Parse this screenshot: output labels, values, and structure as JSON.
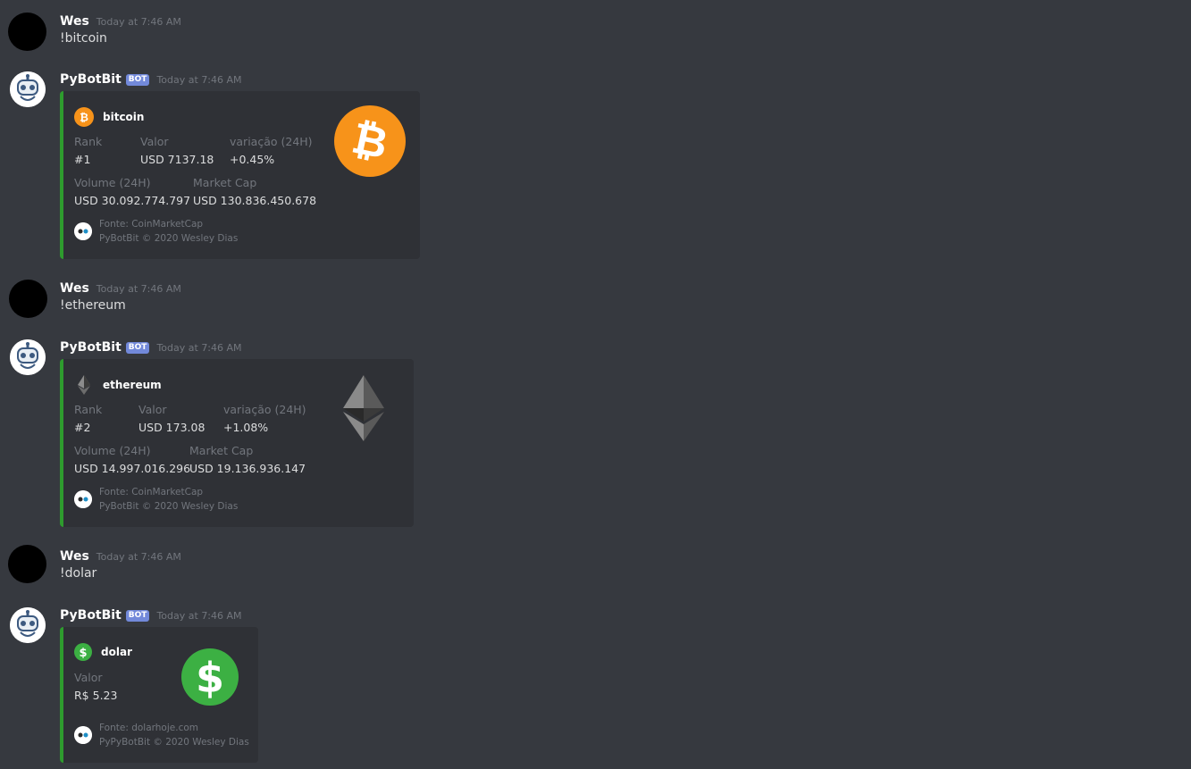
{
  "messages": [
    {
      "type": "user",
      "username": "Wes",
      "timestamp": "Today at 7:46 AM",
      "content": "!bitcoin"
    },
    {
      "type": "bot",
      "username": "PyBotBit",
      "bot_tag": "BOT",
      "timestamp": "Today at 7:46 AM",
      "embed": {
        "accent_color": "#2e9b2e",
        "author": "bitcoin",
        "author_icon": "bitcoin-icon",
        "fields": [
          {
            "name": "Rank",
            "value": "#1"
          },
          {
            "name": "Valor",
            "value": "USD 7137.18"
          },
          {
            "name": "variação (24H)",
            "value": "+0.45%"
          },
          {
            "name": "Volume (24H)",
            "value": "USD 30.092.774.797"
          },
          {
            "name": "Market Cap",
            "value": "USD 130.836.450.678"
          }
        ],
        "thumbnail": "bitcoin-logo",
        "footer_lines": [
          "Fonte: CoinMarketCap",
          "PyBotBit © 2020 Wesley Dias"
        ]
      }
    },
    {
      "type": "user",
      "username": "Wes",
      "timestamp": "Today at 7:46 AM",
      "content": "!ethereum"
    },
    {
      "type": "bot",
      "username": "PyBotBit",
      "bot_tag": "BOT",
      "timestamp": "Today at 7:46 AM",
      "embed": {
        "accent_color": "#2e9b2e",
        "author": "ethereum",
        "author_icon": "ethereum-icon",
        "fields": [
          {
            "name": "Rank",
            "value": "#2"
          },
          {
            "name": "Valor",
            "value": "USD 173.08"
          },
          {
            "name": "variação (24H)",
            "value": "+1.08%"
          },
          {
            "name": "Volume (24H)",
            "value": "USD 14.997.016.296"
          },
          {
            "name": "Market Cap",
            "value": "USD 19.136.936.147"
          }
        ],
        "thumbnail": "ethereum-logo",
        "footer_lines": [
          "Fonte: CoinMarketCap",
          "PyBotBit © 2020 Wesley Dias"
        ]
      }
    },
    {
      "type": "user",
      "username": "Wes",
      "timestamp": "Today at 7:46 AM",
      "content": "!dolar"
    },
    {
      "type": "bot",
      "username": "PyBotBit",
      "bot_tag": "BOT",
      "timestamp": "Today at 7:46 AM",
      "embed": {
        "accent_color": "#2e9b2e",
        "author": "dolar",
        "author_icon": "dollar-icon",
        "fields": [
          {
            "name": "Valor",
            "value": "R$ 5.23"
          }
        ],
        "thumbnail": "dollar-logo",
        "footer_lines": [
          "Fonte: dolarhoje.com",
          "PyPyBotBit © 2020 Wesley Dias"
        ]
      }
    }
  ],
  "colors": {
    "background": "#36393f",
    "embed_background": "#2f3136",
    "embed_accent": "#2e9b2e",
    "bot_tag": "#7289da",
    "bitcoin_orange": "#f7931a",
    "dollar_green": "#3cb043"
  }
}
